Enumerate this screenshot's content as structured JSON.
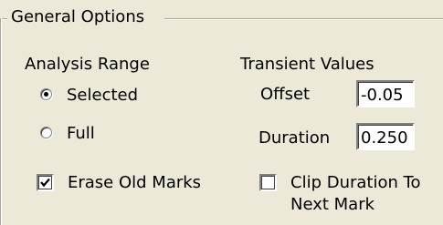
{
  "group_title": "General Options",
  "analysis_range": {
    "label": "Analysis Range",
    "options": [
      {
        "label": "Selected",
        "checked": true
      },
      {
        "label": "Full",
        "checked": false
      }
    ]
  },
  "transient_values": {
    "label": "Transient Values",
    "offset_label": "Offset",
    "offset_value": "-0.05",
    "duration_label": "Duration",
    "duration_value": "0.250"
  },
  "erase_old_marks": {
    "label": "Erase Old Marks",
    "checked": true
  },
  "clip_duration": {
    "label_line1": "Clip Duration To",
    "label_line2": "Next Mark",
    "checked": false
  }
}
